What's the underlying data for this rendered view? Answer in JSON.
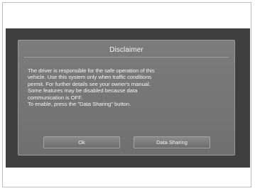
{
  "dialog": {
    "title": "Disclaimer",
    "message_lines": [
      "The driver is responsible for the safe operation of this",
      "vehicle. Use this system only when traffic conditions",
      "permit. For further details see your owner's manual.",
      "Some features may be disabled because data",
      "communication is OFF.",
      "To enable, press the \"Data Sharing\" button."
    ],
    "buttons": {
      "ok_label": "Ok",
      "data_sharing_label": "Data Sharing"
    }
  }
}
